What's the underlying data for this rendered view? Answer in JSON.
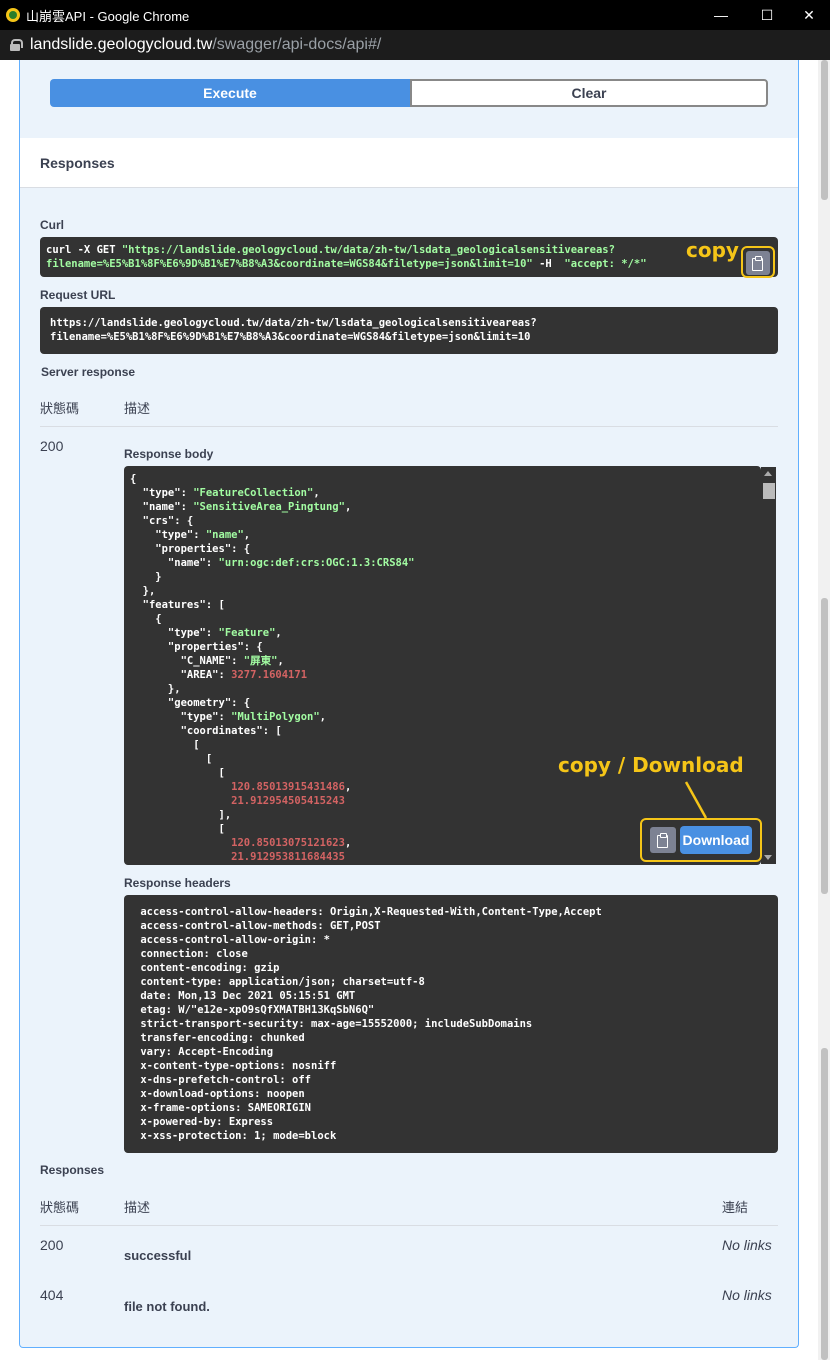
{
  "window": {
    "title": "山崩雲API - Google Chrome",
    "minimize": "—",
    "maximize": "☐",
    "close": "✕"
  },
  "address": {
    "host": "landslide.geologycloud.tw",
    "path": "/swagger/api-docs/api#/"
  },
  "buttons": {
    "execute": "Execute",
    "clear": "Clear",
    "download": "Download"
  },
  "responses_title": "Responses",
  "curl": {
    "label": "Curl",
    "line1_cmd": "curl -X GET ",
    "line1_str": "\"https://landslide.geologycloud.tw/data/zh-tw/lsdata_geologicalsensitiveareas?",
    "line2_str": "filename=%E5%B1%8F%E6%9D%B1%E7%B8%A3&coordinate=WGS84&filetype=json&limit=10\"",
    "line2_cmd": " -H  ",
    "line2_str2": "\"accept: */*\""
  },
  "request_url": {
    "label": "Request URL",
    "line1": "https://landslide.geologycloud.tw/data/zh-tw/lsdata_geologicalsensitiveareas?",
    "line2": "filename=%E5%B1%8F%E6%9D%B1%E7%B8%A3&coordinate=WGS84&filetype=json&limit=10"
  },
  "server_response": {
    "label": "Server response",
    "col_code": "狀態碼",
    "col_desc": "描述",
    "code": "200",
    "body_label": "Response body",
    "headers_label": "Response headers",
    "body_lines": [
      "{",
      "  \"type\": \"FeatureCollection\",",
      "  \"name\": \"SensitiveArea_Pingtung\",",
      "  \"crs\": {",
      "    \"type\": \"name\",",
      "    \"properties\": {",
      "      \"name\": \"urn:ogc:def:crs:OGC:1.3:CRS84\"",
      "    }",
      "  },",
      "  \"features\": [",
      "    {",
      "      \"type\": \"Feature\",",
      "      \"properties\": {",
      "        \"C_NAME\": \"屏東\",",
      "        \"AREA\": 3277.1604171",
      "      },",
      "      \"geometry\": {",
      "        \"type\": \"MultiPolygon\",",
      "        \"coordinates\": [",
      "          [",
      "            [",
      "              [",
      "                120.85013915431486,",
      "                21.912954505415243",
      "              ],",
      "              [",
      "                120.85013075121623,",
      "                21.912953811684435"
    ],
    "header_lines": [
      " access-control-allow-headers: Origin,X-Requested-With,Content-Type,Accept",
      " access-control-allow-methods: GET,POST",
      " access-control-allow-origin: *",
      " connection: close",
      " content-encoding: gzip",
      " content-type: application/json; charset=utf-8",
      " date: Mon,13 Dec 2021 05:15:51 GMT",
      " etag: W/\"e12e-xpO9sQfXMATBH13KqSbN6Q\"",
      " strict-transport-security: max-age=15552000; includeSubDomains",
      " transfer-encoding: chunked",
      " vary: Accept-Encoding",
      " x-content-type-options: nosniff",
      " x-dns-prefetch-control: off",
      " x-download-options: noopen",
      " x-frame-options: SAMEORIGIN",
      " x-powered-by: Express",
      " x-xss-protection: 1; mode=block"
    ]
  },
  "responses_table": {
    "label": "Responses",
    "col_code": "狀態碼",
    "col_desc": "描述",
    "col_links": "連結",
    "rows": [
      {
        "code": "200",
        "desc": "successful",
        "links": "No links"
      },
      {
        "code": "404",
        "desc": "file not found.",
        "links": "No links"
      }
    ]
  },
  "annotations": {
    "copy": "copy",
    "copy_download": "copy / Download"
  },
  "colors": {
    "accent": "#4990e2",
    "highlight": "#f5c518",
    "string": "#a2fca2",
    "number": "#d36363"
  }
}
